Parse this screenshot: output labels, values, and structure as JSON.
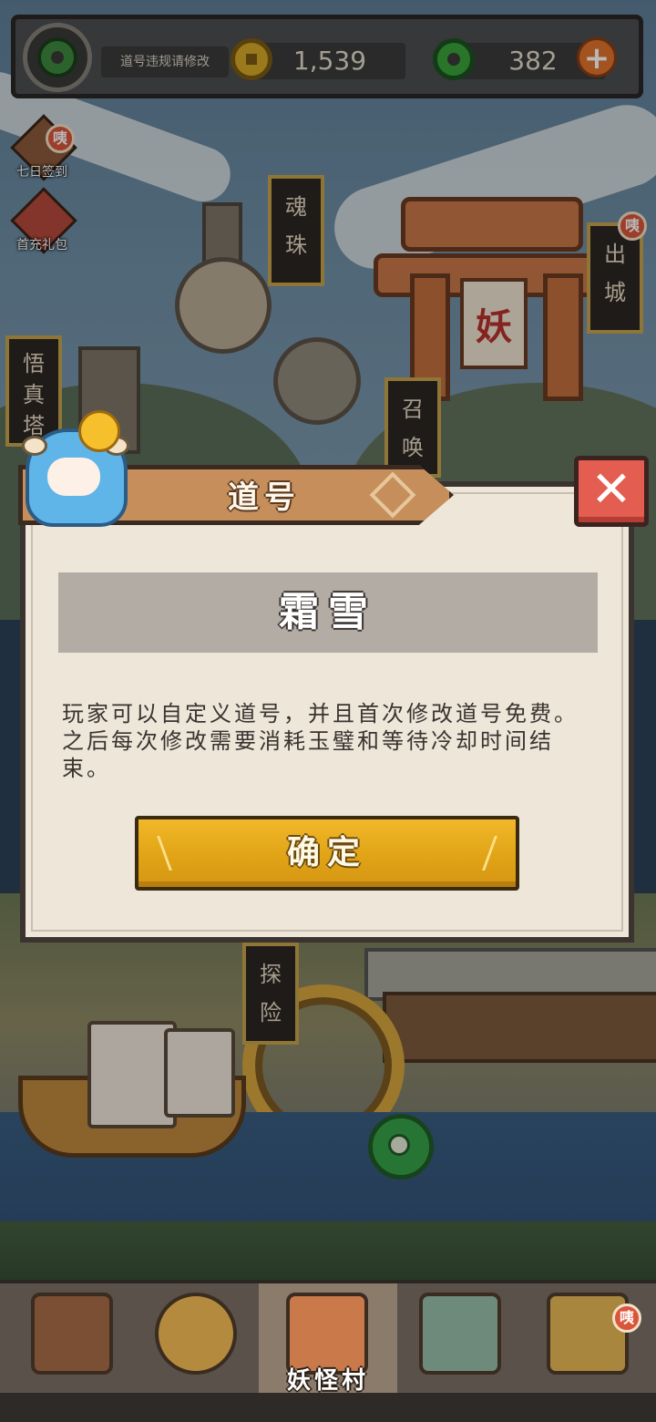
{
  "topbar": {
    "name_notice": "道号违规请修改",
    "gold_amount": "1,539",
    "jade_amount": "382",
    "plus_symbol": "+"
  },
  "side_icons": [
    {
      "label": "七日签到",
      "badge": "咦"
    },
    {
      "label": "首充礼包"
    }
  ],
  "map_signs": {
    "soul_orb": "魂珠",
    "wuzhen_tower": "悟真塔",
    "summon": "召唤",
    "leave_city": "出城",
    "leave_city_badge": "咦",
    "explore": "探险",
    "gate_plaque": "妖"
  },
  "dialog": {
    "title": "道号",
    "close_symbol": "✕",
    "current_name": "霜雪",
    "description": "玩家可以自定义道号，并且首次修改道号免费。之后每次修改需要消耗玉璧和等待冷却时间结束。",
    "confirm_label": "确定"
  },
  "bottom_nav": {
    "active_label": "妖怪村",
    "last_badge": "咦"
  },
  "colors": {
    "dialog_bg": "#ede6d9",
    "banner": "#c58e5b",
    "confirm": "#e0a416",
    "close": "#e35d50",
    "badge": "#d9563b"
  }
}
